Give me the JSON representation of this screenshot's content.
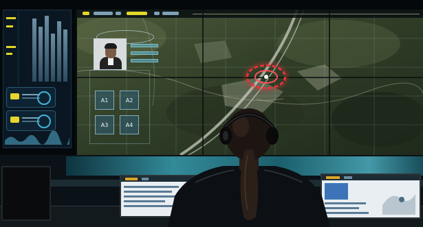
{
  "scene": {
    "description_colors": {
      "accent_cyan": "#3fb6d6",
      "alert_red": "#e8323a",
      "hud_yellow": "#e3d72a",
      "map_green": "#3a4a2c"
    }
  },
  "left_panel": {
    "icons": [
      "bar-chart-icon",
      "gauge-icon",
      "gauge-icon"
    ]
  },
  "id_overlay": {
    "slots": [
      "A1",
      "A2",
      "A3",
      "A4"
    ]
  },
  "target_marker": {
    "icon": "target-reticle-icon"
  }
}
